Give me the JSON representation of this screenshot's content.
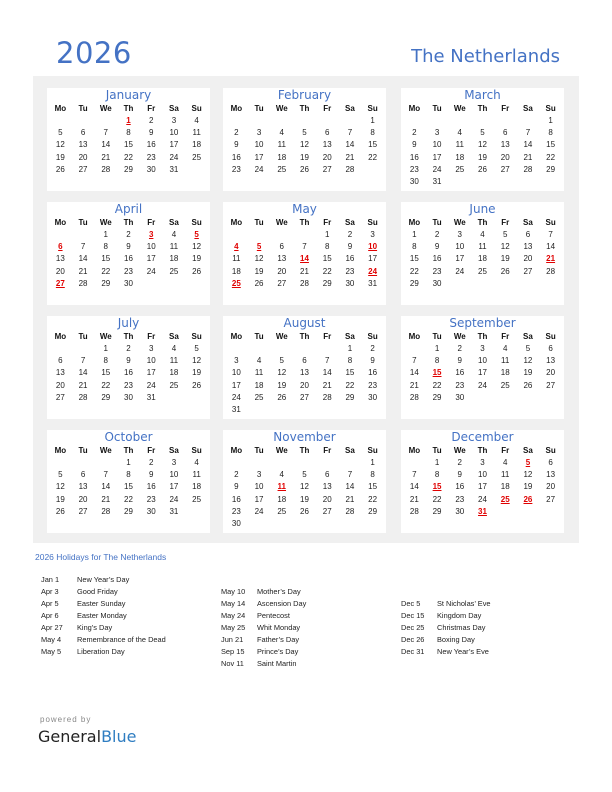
{
  "header": {
    "year": "2026",
    "country": "The Netherlands"
  },
  "weekdays": [
    "Mo",
    "Tu",
    "We",
    "Th",
    "Fr",
    "Sa",
    "Su"
  ],
  "months": [
    {
      "name": "January",
      "offset": 3,
      "days": 31,
      "holidays": [
        1
      ]
    },
    {
      "name": "February",
      "offset": 6,
      "days": 28,
      "holidays": []
    },
    {
      "name": "March",
      "offset": 6,
      "days": 31,
      "holidays": []
    },
    {
      "name": "April",
      "offset": 2,
      "days": 30,
      "holidays": [
        3,
        5,
        6,
        27
      ]
    },
    {
      "name": "May",
      "offset": 4,
      "days": 31,
      "holidays": [
        4,
        5,
        10,
        14,
        24,
        25
      ]
    },
    {
      "name": "June",
      "offset": 0,
      "days": 30,
      "holidays": [
        21
      ]
    },
    {
      "name": "July",
      "offset": 2,
      "days": 31,
      "holidays": []
    },
    {
      "name": "August",
      "offset": 5,
      "days": 31,
      "holidays": []
    },
    {
      "name": "September",
      "offset": 1,
      "days": 30,
      "holidays": [
        15
      ]
    },
    {
      "name": "October",
      "offset": 3,
      "days": 31,
      "holidays": []
    },
    {
      "name": "November",
      "offset": 6,
      "days": 30,
      "holidays": [
        11
      ]
    },
    {
      "name": "December",
      "offset": 1,
      "days": 31,
      "holidays": [
        5,
        15,
        25,
        26,
        31
      ]
    }
  ],
  "holidays_title": "2026 Holidays for The Netherlands",
  "holiday_columns": [
    [
      {
        "date": "Jan 1",
        "name": "New Year’s Day"
      },
      {
        "date": "Apr 3",
        "name": "Good Friday"
      },
      {
        "date": "Apr 5",
        "name": "Easter Sunday"
      },
      {
        "date": "Apr 6",
        "name": "Easter Monday"
      },
      {
        "date": "Apr 27",
        "name": "King’s Day"
      },
      {
        "date": "May 4",
        "name": "Remembrance of the Dead"
      },
      {
        "date": "May 5",
        "name": "Liberation Day"
      }
    ],
    [
      {
        "date": "May 10",
        "name": "Mother’s Day"
      },
      {
        "date": "May 14",
        "name": "Ascension Day"
      },
      {
        "date": "May 24",
        "name": "Pentecost"
      },
      {
        "date": "May 25",
        "name": "Whit Monday"
      },
      {
        "date": "Jun 21",
        "name": "Father’s Day"
      },
      {
        "date": "Sep 15",
        "name": "Prince’s Day"
      },
      {
        "date": "Nov 11",
        "name": "Saint Martin"
      }
    ],
    [
      {
        "date": "Dec 5",
        "name": "St Nicholas’ Eve"
      },
      {
        "date": "Dec 15",
        "name": "Kingdom Day"
      },
      {
        "date": "Dec 25",
        "name": "Christmas Day"
      },
      {
        "date": "Dec 26",
        "name": "Boxing Day"
      },
      {
        "date": "Dec 31",
        "name": "New Year’s Eve"
      }
    ]
  ],
  "footer": {
    "powered_by": "powered by",
    "brand_general": "General",
    "brand_blue": "Blue"
  },
  "colors": {
    "accent": "#4472c4",
    "holiday": "#e00000",
    "panel_bg": "#f0f0f0"
  }
}
